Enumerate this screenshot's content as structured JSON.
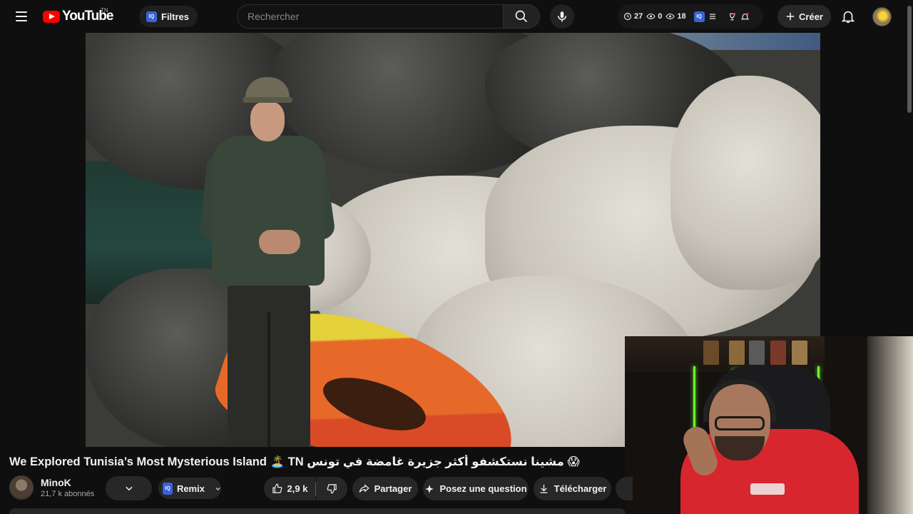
{
  "header": {
    "logo_text": "YouTube",
    "logo_country": "TN",
    "filter_label": "Filtres",
    "filter_badge": "IQ",
    "search": {
      "placeholder": "Rechercher",
      "value": ""
    },
    "extension": {
      "stat1": "27",
      "stat2": "0",
      "stat3": "18",
      "badge": "IQ"
    },
    "create_label": "Créer"
  },
  "video": {
    "title": "We Explored Tunisia’s Most Mysterious Island 🏝️ TN مشينا نستكشفو أكثر جزيرة غامضة في تونس 😱"
  },
  "channel": {
    "name": "MinoK",
    "subscribers": "21,7 k abonnés"
  },
  "actions": {
    "remix_label": "Remix",
    "remix_badge": "IQ",
    "like_count": "2,9 k",
    "share_label": "Partager",
    "ask_label": "Posez une question",
    "download_label": "Télécharger"
  },
  "colors": {
    "background": "#0f0f0f",
    "pill": "#272727",
    "brand_red": "#ff0000",
    "iq_blue": "#3a63d8"
  },
  "icons": [
    "menu-icon",
    "youtube-logo-icon",
    "search-icon",
    "mic-icon",
    "clock-icon",
    "eye-icon",
    "bell-icon",
    "plus-icon",
    "chevron-down-icon",
    "thumbs-up-icon",
    "thumbs-down-icon",
    "share-icon",
    "sparkle-icon",
    "download-icon"
  ]
}
